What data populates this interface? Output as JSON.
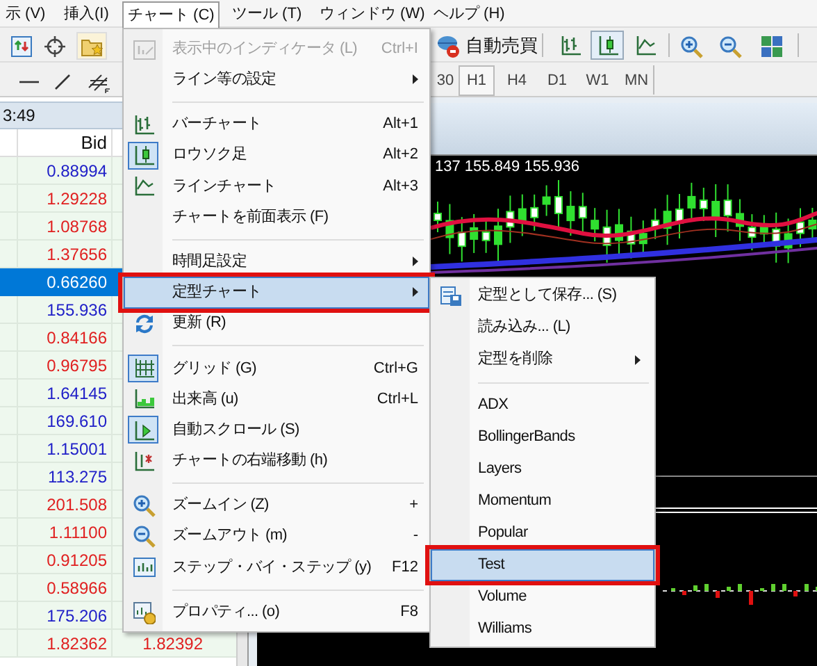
{
  "menubar": [
    {
      "label": "示 (V)",
      "selected": false
    },
    {
      "label": "挿入(I)",
      "selected": false
    },
    {
      "label": "チャート (C)",
      "selected": true
    },
    {
      "label": "ツール (T)",
      "selected": false
    },
    {
      "label": "ウィンドウ (W)",
      "selected": false
    },
    {
      "label": "ヘルプ (H)",
      "selected": false
    }
  ],
  "toolbar": {
    "autotrade_label": "自動売買",
    "chart_buttons": [
      {
        "pressed": false
      },
      {
        "pressed": true
      },
      {
        "pressed": false
      }
    ]
  },
  "timeframes": [
    {
      "label": "30",
      "selected": false
    },
    {
      "label": "H1",
      "selected": true
    },
    {
      "label": "H4",
      "selected": false
    },
    {
      "label": "D1",
      "selected": false
    },
    {
      "label": "W1",
      "selected": false
    },
    {
      "label": "MN",
      "selected": false
    }
  ],
  "market_watch": {
    "time": "3:49",
    "column_bid": "Bid",
    "rows": [
      {
        "bid": "0.88994",
        "color": "#2020c8",
        "selected": false
      },
      {
        "bid": "1.29228",
        "color": "#e02020",
        "selected": false
      },
      {
        "bid": "1.08768",
        "color": "#e02020",
        "selected": false
      },
      {
        "bid": "1.37656",
        "color": "#e02020",
        "selected": false
      },
      {
        "bid": "0.66260",
        "selected": true
      },
      {
        "bid": "155.936",
        "color": "#2020c8",
        "selected": false
      },
      {
        "bid": "0.84166",
        "color": "#e02020",
        "selected": false
      },
      {
        "bid": "0.96795",
        "color": "#e02020",
        "selected": false
      },
      {
        "bid": "1.64145",
        "color": "#2020c8",
        "selected": false
      },
      {
        "bid": "169.610",
        "color": "#2020c8",
        "selected": false
      },
      {
        "bid": "1.15001",
        "color": "#2020c8",
        "selected": false
      },
      {
        "bid": "113.275",
        "color": "#2020c8",
        "selected": false
      },
      {
        "bid": "201.508",
        "color": "#e02020",
        "selected": false
      },
      {
        "bid": "1.11100",
        "color": "#e02020",
        "selected": false
      },
      {
        "bid": "0.91205",
        "color": "#e02020",
        "selected": false
      },
      {
        "bid": "0.58966",
        "color": "#e02020",
        "selected": false
      },
      {
        "bid": "175.206",
        "color": "#2020c8",
        "selected": false
      },
      {
        "bid": "1.82362",
        "ask": "1.82392",
        "color": "#e02020",
        "selected": false
      }
    ]
  },
  "chart": {
    "price_line": "137 155.849 155.936"
  },
  "chart_menu": [
    {
      "kind": "item",
      "label": "表示中のインディケータ (L)",
      "shortcut": "Ctrl+I",
      "disabled": true,
      "checked": false,
      "submenu": false,
      "selected": false,
      "annotated": false
    },
    {
      "kind": "item",
      "label": "ライン等の設定",
      "disabled": false,
      "checked": false,
      "submenu": true,
      "selected": false,
      "annotated": false
    },
    {
      "kind": "separator"
    },
    {
      "kind": "item",
      "label": "バーチャート",
      "shortcut": "Alt+1",
      "disabled": false,
      "checked": false,
      "submenu": false,
      "selected": false,
      "annotated": false
    },
    {
      "kind": "item",
      "label": "ロウソク足",
      "shortcut": "Alt+2",
      "disabled": false,
      "checked": true,
      "submenu": false,
      "selected": false,
      "annotated": false
    },
    {
      "kind": "item",
      "label": "ラインチャート",
      "shortcut": "Alt+3",
      "disabled": false,
      "checked": false,
      "submenu": false,
      "selected": false,
      "annotated": false
    },
    {
      "kind": "item",
      "label": "チャートを前面表示 (F)",
      "disabled": false,
      "checked": false,
      "submenu": false,
      "selected": false,
      "annotated": false
    },
    {
      "kind": "separator"
    },
    {
      "kind": "item",
      "label": "時間足設定",
      "disabled": false,
      "checked": false,
      "submenu": true,
      "selected": false,
      "annotated": false
    },
    {
      "kind": "item",
      "label": "定型チャート",
      "disabled": false,
      "checked": false,
      "submenu": true,
      "selected": true,
      "annotated": true
    },
    {
      "kind": "item",
      "label": "更新 (R)",
      "disabled": false,
      "checked": false,
      "submenu": false,
      "selected": false,
      "annotated": false
    },
    {
      "kind": "separator"
    },
    {
      "kind": "item",
      "label": "グリッド (G)",
      "shortcut": "Ctrl+G",
      "disabled": false,
      "checked": true,
      "submenu": false,
      "selected": false,
      "annotated": false
    },
    {
      "kind": "item",
      "label": "出来高 (u)",
      "shortcut": "Ctrl+L",
      "disabled": false,
      "checked": false,
      "submenu": false,
      "selected": false,
      "annotated": false
    },
    {
      "kind": "item",
      "label": "自動スクロール (S)",
      "disabled": false,
      "checked": true,
      "submenu": false,
      "selected": false,
      "annotated": false
    },
    {
      "kind": "item",
      "label": "チャートの右端移動 (h)",
      "disabled": false,
      "checked": false,
      "submenu": false,
      "selected": false,
      "annotated": false
    },
    {
      "kind": "separator"
    },
    {
      "kind": "item",
      "label": "ズームイン (Z)",
      "shortcut": "+",
      "disabled": false,
      "checked": false,
      "submenu": false,
      "selected": false,
      "annotated": false
    },
    {
      "kind": "item",
      "label": "ズームアウト (m)",
      "shortcut": "-",
      "disabled": false,
      "checked": false,
      "submenu": false,
      "selected": false,
      "annotated": false
    },
    {
      "kind": "item",
      "label": "ステップ・バイ・ステップ (y)",
      "shortcut": "F12",
      "disabled": false,
      "checked": false,
      "submenu": false,
      "selected": false,
      "annotated": false
    },
    {
      "kind": "separator"
    },
    {
      "kind": "item",
      "label": "プロパティ... (o)",
      "shortcut": "F8",
      "disabled": false,
      "checked": false,
      "submenu": false,
      "selected": false,
      "annotated": false
    }
  ],
  "template_submenu": [
    {
      "kind": "item",
      "label": "定型として保存... (S)",
      "submenu": false,
      "selected": false,
      "annotated": false
    },
    {
      "kind": "item",
      "label": "読み込み... (L)",
      "submenu": false,
      "selected": false,
      "annotated": false
    },
    {
      "kind": "item",
      "label": "定型を削除",
      "submenu": true,
      "selected": false,
      "annotated": false
    },
    {
      "kind": "separator"
    },
    {
      "kind": "item",
      "label": "ADX",
      "submenu": false,
      "selected": false,
      "annotated": false
    },
    {
      "kind": "item",
      "label": "BollingerBands",
      "submenu": false,
      "selected": false,
      "annotated": false
    },
    {
      "kind": "item",
      "label": "Layers",
      "submenu": false,
      "selected": false,
      "annotated": false
    },
    {
      "kind": "item",
      "label": "Momentum",
      "submenu": false,
      "selected": false,
      "annotated": false
    },
    {
      "kind": "item",
      "label": "Popular",
      "submenu": false,
      "selected": false,
      "annotated": false
    },
    {
      "kind": "item",
      "label": "Test",
      "submenu": false,
      "selected": true,
      "annotated": true
    },
    {
      "kind": "item",
      "label": "Volume",
      "submenu": false,
      "selected": false,
      "annotated": false
    },
    {
      "kind": "item",
      "label": "Williams",
      "submenu": false,
      "selected": false,
      "annotated": false
    }
  ]
}
